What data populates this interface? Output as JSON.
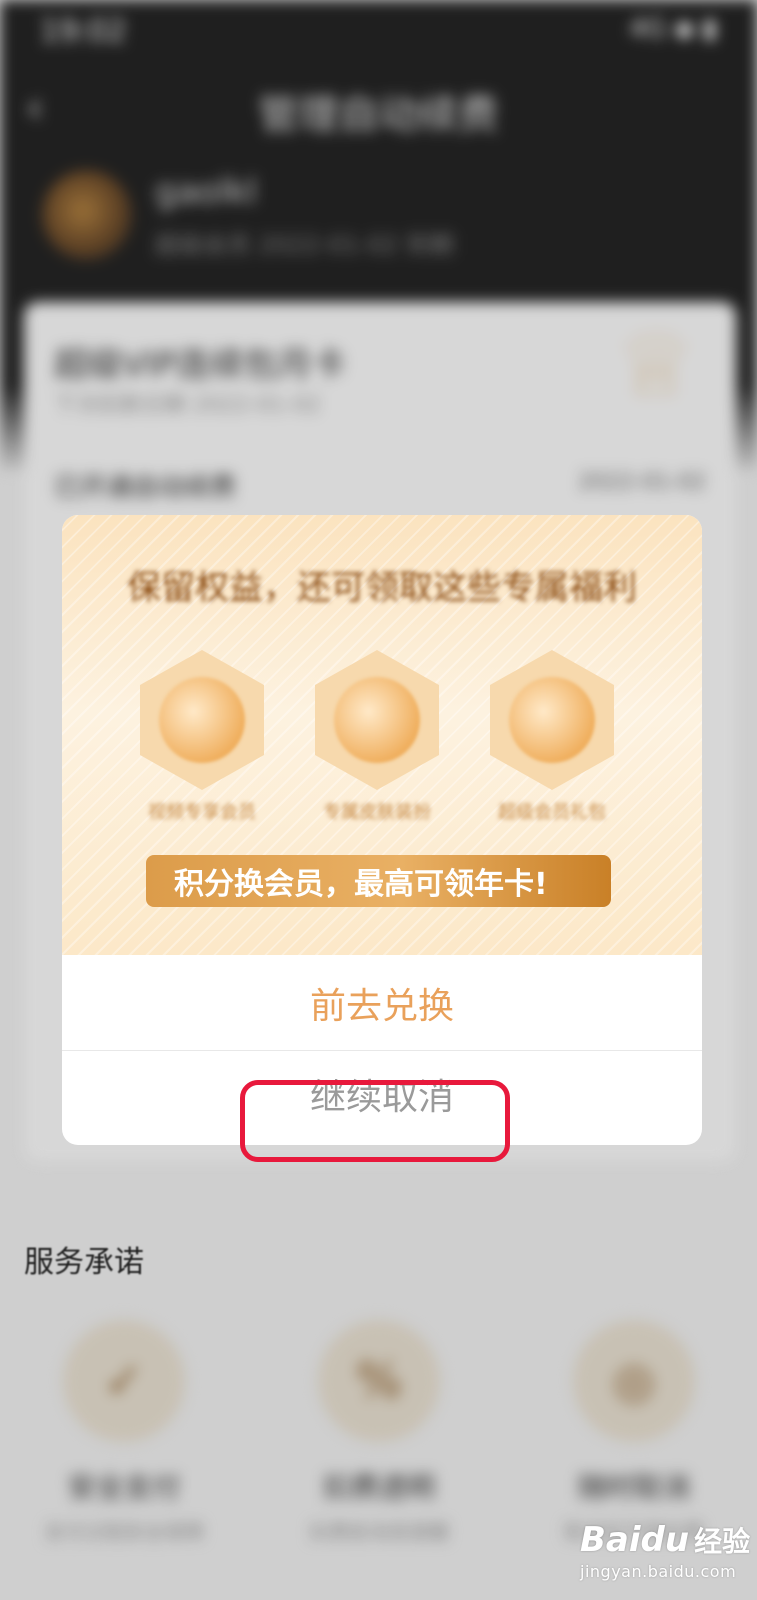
{
  "status_bar": {
    "time": "19:02",
    "icons": "4G ◆ ▮"
  },
  "header": {
    "title": "管理自动续费"
  },
  "account": {
    "username": "gaolkl",
    "subtitle": "超级会员 2022-01-02 到期"
  },
  "vip_card": {
    "title": "超级VIP连续包月卡",
    "subtitle": "下次扣款日期 2022-01-02",
    "row_label": "已开通自动续费",
    "row_date": "2022-01-02"
  },
  "modal": {
    "banner_title": "保留权益，还可领取这些专属福利",
    "benefits": [
      {
        "label": "视频专享会员"
      },
      {
        "label": "专属皮肤装扮"
      },
      {
        "label": "超级会员礼包"
      }
    ],
    "promo_text": "积分换会员，最高可领年卡!",
    "primary_button": "前去兑换",
    "secondary_button": "继续取消"
  },
  "services": {
    "title": "服务承诺",
    "items": [
      {
        "label": "安全支付",
        "sub": "支付过程安全保障",
        "icon": "shield-check-icon"
      },
      {
        "label": "扣费透明",
        "sub": "扣费前消息提醒",
        "icon": "clipboard-percent-icon"
      },
      {
        "label": "随时取消",
        "sub": "取消后不再扣费",
        "icon": "cancel-circle-icon"
      }
    ]
  },
  "watermark": {
    "logo": "Baidu",
    "brand": "经验",
    "url": "jingyan.baidu.com"
  },
  "colors": {
    "accent": "#e9a15b",
    "highlight": "#e8193c",
    "promo": "#dc9c4a"
  }
}
